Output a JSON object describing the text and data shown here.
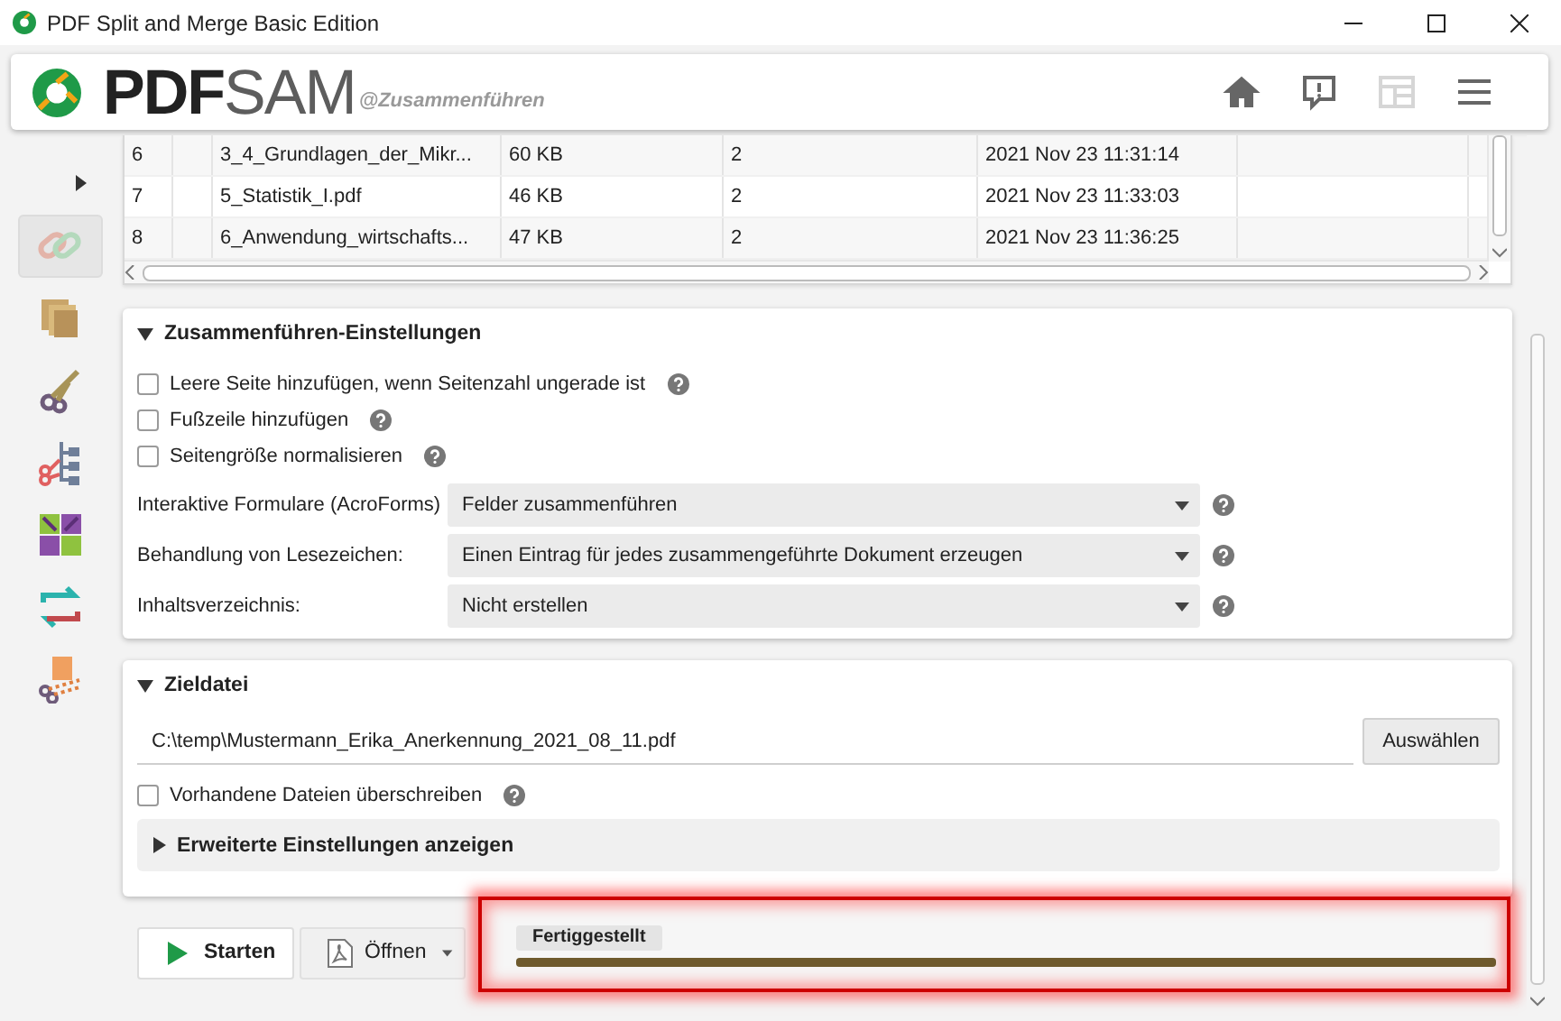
{
  "window": {
    "title": "PDF Split and Merge Basic Edition"
  },
  "header": {
    "logo_primary": "PDF",
    "logo_secondary": "SAM",
    "module": "@Zusammenführen",
    "buttons": [
      {
        "kind": "home",
        "disabled": false
      },
      {
        "kind": "feedback",
        "disabled": false
      },
      {
        "kind": "dashboard",
        "disabled": true
      },
      {
        "kind": "menu",
        "disabled": false
      }
    ]
  },
  "sidebar": {
    "items": [
      {
        "kind": "merge",
        "selected": true
      },
      {
        "kind": "mix",
        "selected": false
      },
      {
        "kind": "split",
        "selected": false
      },
      {
        "kind": "split-bookmarks",
        "selected": false
      },
      {
        "kind": "grid",
        "selected": false
      },
      {
        "kind": "rotate",
        "selected": false
      },
      {
        "kind": "extract",
        "selected": false
      }
    ]
  },
  "table": {
    "rows": [
      {
        "number": "6",
        "name": "3_4_Grundlagen_der_Mikr...",
        "size": "60 KB",
        "pages": "2",
        "modified": "2021 Nov 23 11:31:14"
      },
      {
        "number": "7",
        "name": "5_Statistik_I.pdf",
        "size": "46 KB",
        "pages": "2",
        "modified": "2021 Nov 23 11:33:03"
      },
      {
        "number": "8",
        "name": "6_Anwendung_wirtschafts...",
        "size": "47 KB",
        "pages": "2",
        "modified": "2021 Nov 23 11:36:25"
      }
    ]
  },
  "settings": {
    "title": "Zusammenführen-Einstellungen",
    "expanded": true,
    "options": [
      {
        "label": "Leere Seite hinzufügen, wenn Seitenzahl ungerade ist",
        "checked": false
      },
      {
        "label": "Fußzeile hinzufügen",
        "checked": false
      },
      {
        "label": "Seitengröße normalisieren",
        "checked": false
      }
    ],
    "selects": [
      {
        "label": "Interaktive Formulare (AcroForms)",
        "value": "Felder zusammenführen"
      },
      {
        "label": "Behandlung von Lesezeichen:",
        "value": "Einen Eintrag für jedes zusammengeführte Dokument erzeugen"
      },
      {
        "label": "Inhaltsverzeichnis:",
        "value": "Nicht erstellen"
      }
    ]
  },
  "target": {
    "title": "Zieldatei",
    "expanded": true,
    "path": "C:\\temp\\Mustermann_Erika_Anerkennung_2021_08_11.pdf",
    "browse_button": "Auswählen",
    "overwrite": {
      "label": "Vorhandene Dateien überschreiben",
      "checked": false
    },
    "advanced": {
      "label": "Erweiterte Einstellungen anzeigen",
      "expanded": false
    }
  },
  "actions": {
    "run_button": "Starten",
    "open_button": "Öffnen",
    "progress": {
      "label": "Fertiggestellt",
      "level": 1
    }
  }
}
